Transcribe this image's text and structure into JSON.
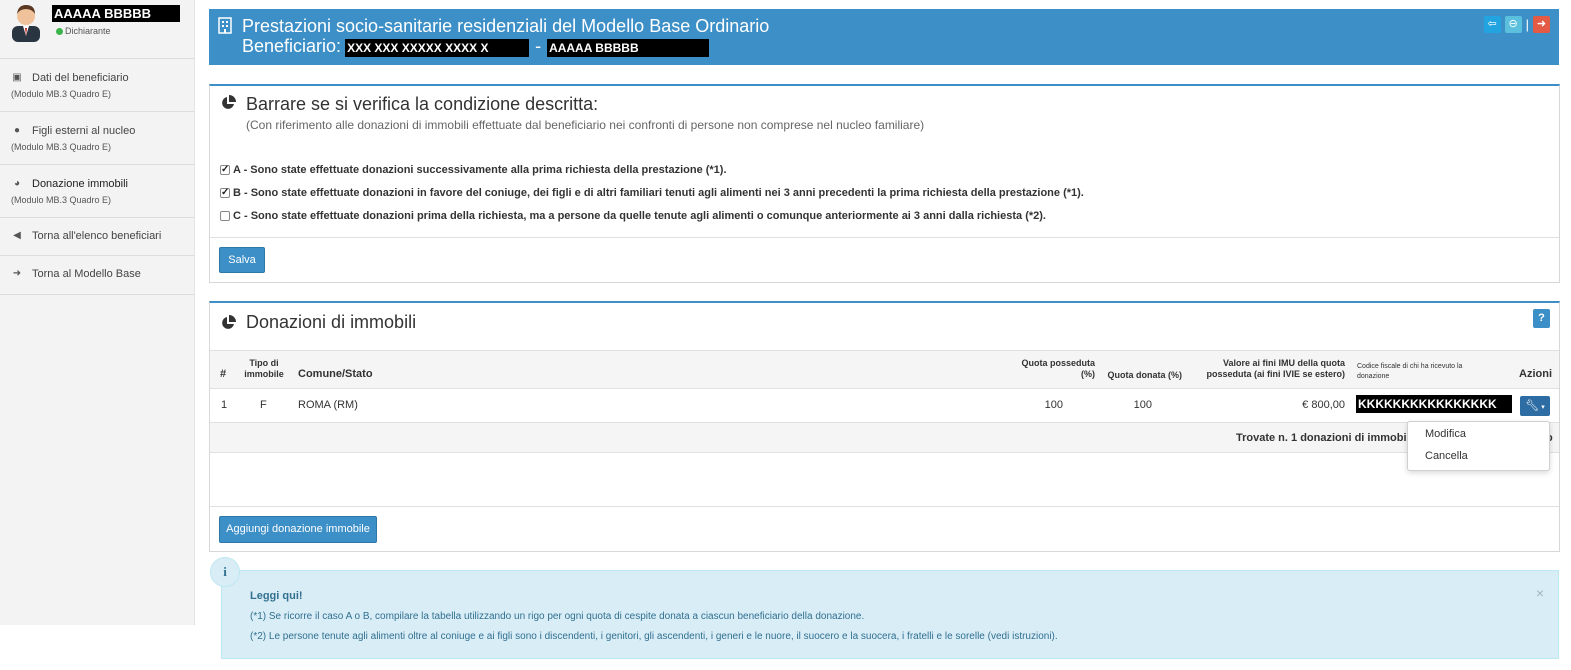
{
  "user": {
    "name": "AAAAA BBBBB",
    "role": "Dichiarante"
  },
  "sidebar": {
    "items": [
      {
        "label": "Dati del beneficiario",
        "sub": "(Modulo MB.3 Quadro E)",
        "icon": "id-card-icon"
      },
      {
        "label": "Figli esterni al nucleo",
        "sub": "(Modulo MB.3 Quadro E)",
        "icon": "users-icon"
      },
      {
        "label": "Donazione immobili",
        "sub": "(Modulo MB.3 Quadro E)",
        "icon": "pie-chart-icon"
      },
      {
        "label": "Torna all'elenco beneficiari",
        "sub": "",
        "icon": "circle-left-icon"
      },
      {
        "label": "Torna al Modello Base",
        "sub": "",
        "icon": "sign-out-icon"
      }
    ]
  },
  "header": {
    "title": "Prestazioni socio-sanitarie residenziali del Modello Base Ordinario",
    "beneficiary_label": "Beneficiario:",
    "beneficiary_code": "XXX XXX XXXXX XXXX X",
    "separator": "-",
    "beneficiary_name": "AAAAA BBBBB"
  },
  "conditions": {
    "title": "Barrare se si verifica la condizione descritta:",
    "subtitle": "(Con riferimento alle donazioni di immobili effettuate dal beneficiario nei confronti di persone non comprese nel nucleo familiare)",
    "options": [
      {
        "text": "A - Sono state effettuate donazioni successivamente alla prima richiesta della prestazione (*1).",
        "checked": true
      },
      {
        "text": "B - Sono state effettuate donazioni in favore del coniuge, dei figli e di altri familiari tenuti agli alimenti nei 3 anni precedenti la prima richiesta della prestazione (*1).",
        "checked": true
      },
      {
        "text": "C - Sono state effettuate donazioni prima della richiesta, ma a persone da quelle tenute agli alimenti o comunque anteriormente ai 3 anni dalla richiesta (*2).",
        "checked": false
      }
    ],
    "save_label": "Salva"
  },
  "donations": {
    "title": "Donazioni di immobili",
    "help_label": "?",
    "columns": {
      "num": "#",
      "tipo": "Tipo di immobile",
      "comune": "Comune/Stato",
      "quota_posseduta": "Quota posseduta (%)",
      "quota_donata": "Quota donata (%)",
      "valore": "Valore ai fini IMU della quota posseduta (ai fini IVIE se estero)",
      "codice": "Codice fiscale di chi ha ricevuto la donazione",
      "azioni": "Azioni"
    },
    "rows": [
      {
        "num": "1",
        "tipo": "F",
        "comune": "ROMA (RM)",
        "quota_posseduta": "100",
        "quota_donata": "100",
        "valore": "€ 800,00",
        "codice": "KKKKKKKKKKKKKKKK"
      }
    ],
    "footer": "Trovate n. 1 donazioni di immobi",
    "footer_tail": "o",
    "add_label": "Aggiungi donazione immobile",
    "menu": [
      "Modifica",
      "Cancella"
    ]
  },
  "info": {
    "icon": "i",
    "title": "Leggi qui!",
    "lines": [
      "(*1) Se ricorre il caso A o B, compilare la tabella utilizzando un rigo per ogni quota di cespite donata a ciascun beneficiario della donazione.",
      "(*2) Le persone tenute agli alimenti oltre al coniuge e ai figli sono i discendenti, i genitori, gli ascendenti, i generi e le nuore, il suocero e la suocera, i fratelli e le sorelle (vedi istruzioni)."
    ],
    "close": "×"
  },
  "colors": {
    "primary": "#3d8fc7",
    "danger": "#e35b45",
    "info_bg": "#d9edf7"
  }
}
